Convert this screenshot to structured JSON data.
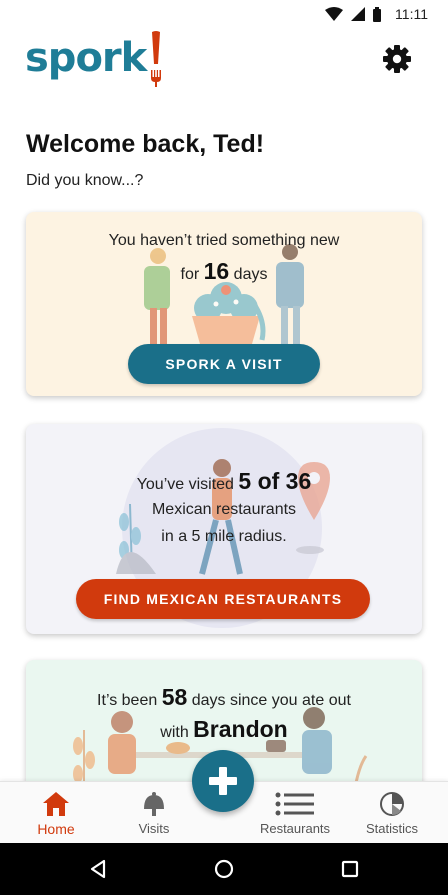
{
  "status_bar": {
    "time": "11:11"
  },
  "app": {
    "logo_text": "spork",
    "brand_color": "#1f7d97",
    "accent_color": "#d13a0d"
  },
  "header": {
    "settings_icon": "gear-icon"
  },
  "welcome": {
    "title": "Welcome back, Ted!",
    "subtitle": "Did you know...?"
  },
  "cards": {
    "new_visit": {
      "line1": "You haven’t tried something new",
      "prefix": "for ",
      "days": "16",
      "suffix": " days",
      "button": "SPORK A VISIT"
    },
    "mexican": {
      "prefix": "You’ve visited ",
      "count": "5 of 36",
      "line2": "Mexican restaurants",
      "line3": "in a 5 mile radius.",
      "button": "FIND MEXICAN RESTAURANTS"
    },
    "friend": {
      "prefix": "It’s been ",
      "days": "58",
      "suffix": " days since you ate out",
      "with": "with ",
      "name": "Brandon"
    }
  },
  "bottom_nav": {
    "items": [
      {
        "label": "Home",
        "icon": "home-icon",
        "active": true
      },
      {
        "label": "Visits",
        "icon": "cloche-icon",
        "active": false
      },
      {
        "label": "Restaurants",
        "icon": "list-icon",
        "active": false
      },
      {
        "label": "Statistics",
        "icon": "pie-chart-icon",
        "active": false
      }
    ],
    "fab_icon": "plus-icon"
  },
  "system_nav": {
    "icons": [
      "back-icon",
      "home-circle-icon",
      "recents-icon"
    ]
  }
}
